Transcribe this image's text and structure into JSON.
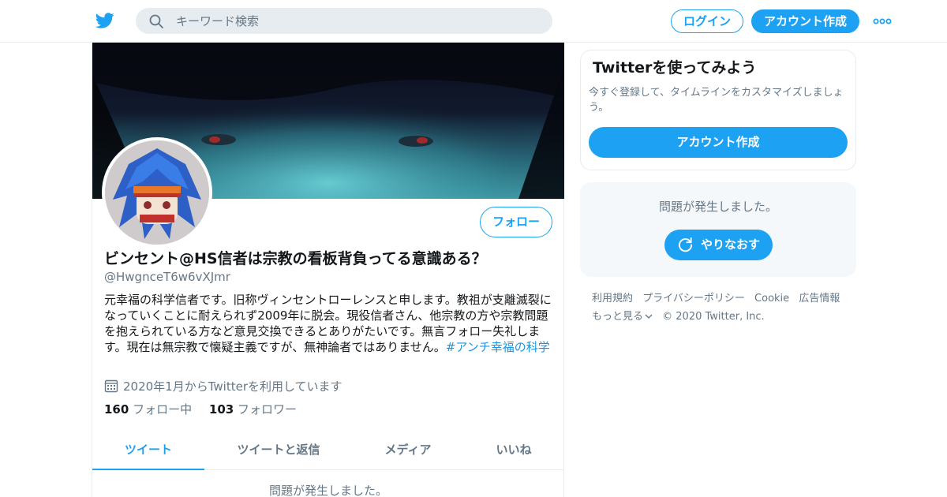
{
  "header": {
    "search_placeholder": "キーワード検索",
    "login_label": "ログイン",
    "signup_label": "アカウント作成"
  },
  "profile": {
    "follow_label": "フォロー",
    "name": "ビンセント@HS信者は宗教の看板背負ってる意識ある？",
    "handle": "@HwgnceT6w6vXJmr",
    "bio": "元幸福の科学信者です。旧称ヴィンセントローレンスと申します。教祖が支離滅裂になっていくことに耐えられず2009年に脱会。現役信者さん、他宗教の方や宗教問題を抱えられている方など意見交換できるとありがたいです。無言フォロー失礼します。現在は無宗教で懐疑主義ですが、無神論者ではありません。",
    "bio_hashtag": "#アンチ幸福の科学",
    "joined": "2020年1月からTwitterを利用しています",
    "following_count": "160",
    "following_label": "フォロー中",
    "followers_count": "103",
    "followers_label": "フォロワー"
  },
  "tabs": [
    {
      "label": "ツイート",
      "active": true
    },
    {
      "label": "ツイートと返信",
      "active": false
    },
    {
      "label": "メディア",
      "active": false
    },
    {
      "label": "いいね",
      "active": false
    }
  ],
  "timeline": {
    "error_message": "問題が発生しました。"
  },
  "sidebar": {
    "signup_card": {
      "title": "Twitterを使ってみよう",
      "subtitle": "今すぐ登録して、タイムラインをカスタマイズしましょう。",
      "button_label": "アカウント作成"
    },
    "error_card": {
      "message": "問題が発生しました。",
      "retry_label": "やりなおす"
    }
  },
  "footer": {
    "links": [
      "利用規約",
      "プライバシーポリシー",
      "Cookie",
      "広告情報"
    ],
    "more_label": "もっと見る",
    "copyright": "© 2020 Twitter, Inc."
  },
  "colors": {
    "accent": "#1da1f2",
    "secondary_text": "#657786",
    "border": "#e6ecf0",
    "hashtag": "#1b95e0"
  },
  "icons": [
    "twitter-bird-icon",
    "search-icon",
    "more-dots-icon",
    "calendar-icon",
    "refresh-icon",
    "chevron-down-icon"
  ]
}
